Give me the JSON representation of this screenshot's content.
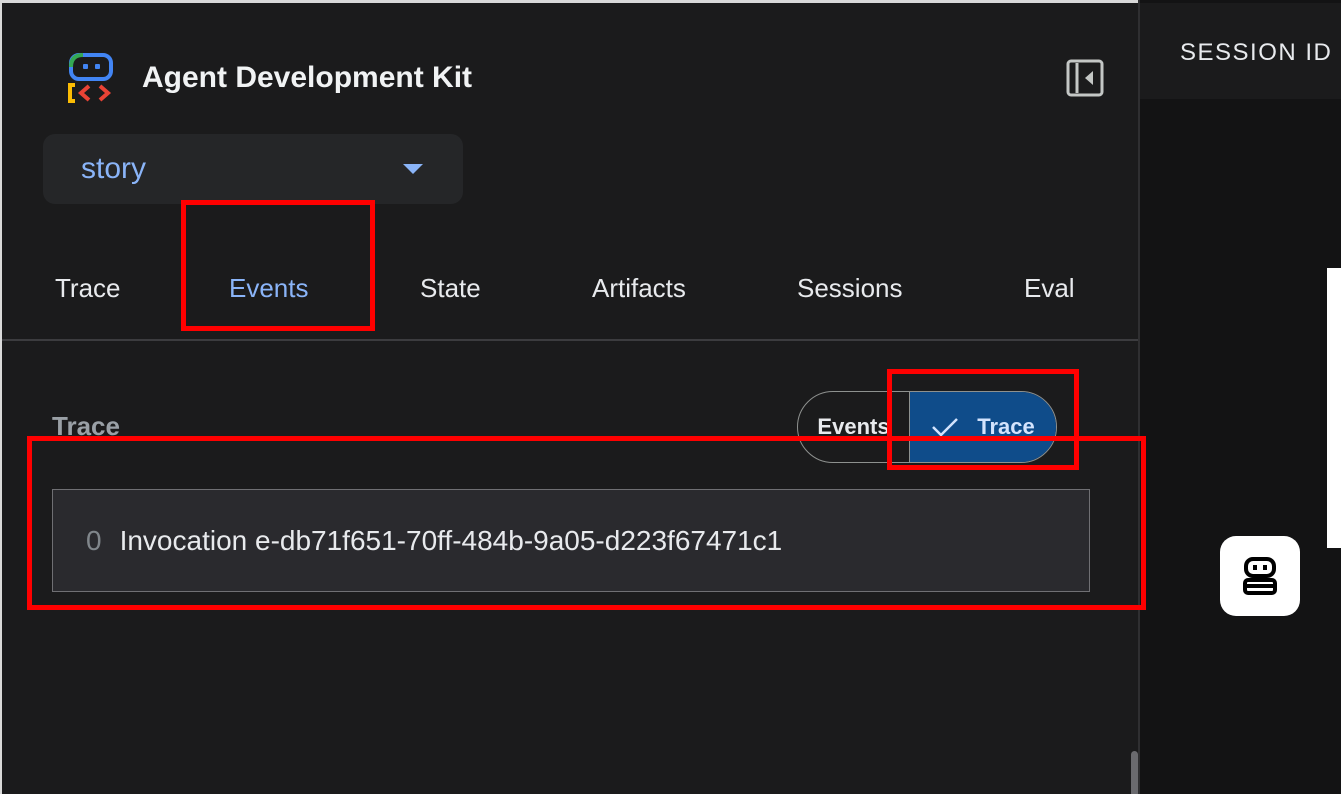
{
  "app": {
    "title": "Agent Development Kit",
    "selected_app": "story"
  },
  "tabs": [
    {
      "label": "Trace"
    },
    {
      "label": "Events",
      "active": true
    },
    {
      "label": "State"
    },
    {
      "label": "Artifacts"
    },
    {
      "label": "Sessions"
    },
    {
      "label": "Eval"
    }
  ],
  "section": {
    "title": "Trace"
  },
  "view_toggle": {
    "events_label": "Events",
    "trace_label": "Trace",
    "selected": "Trace"
  },
  "invocations": [
    {
      "index": "0",
      "label": "Invocation e-db71f651-70ff-484b-9a05-d223f67471c1"
    }
  ],
  "main": {
    "session_label": "SESSION ID"
  },
  "icons": {
    "logo": "adk-logo-icon",
    "collapse": "panel-collapse-icon",
    "caret": "dropdown-caret-icon",
    "check": "check-icon",
    "bot": "robot-icon"
  },
  "colors": {
    "accent": "#8ab4f8",
    "toggle_selected_bg": "#0f4c8a",
    "annotation": "#ff0000"
  }
}
